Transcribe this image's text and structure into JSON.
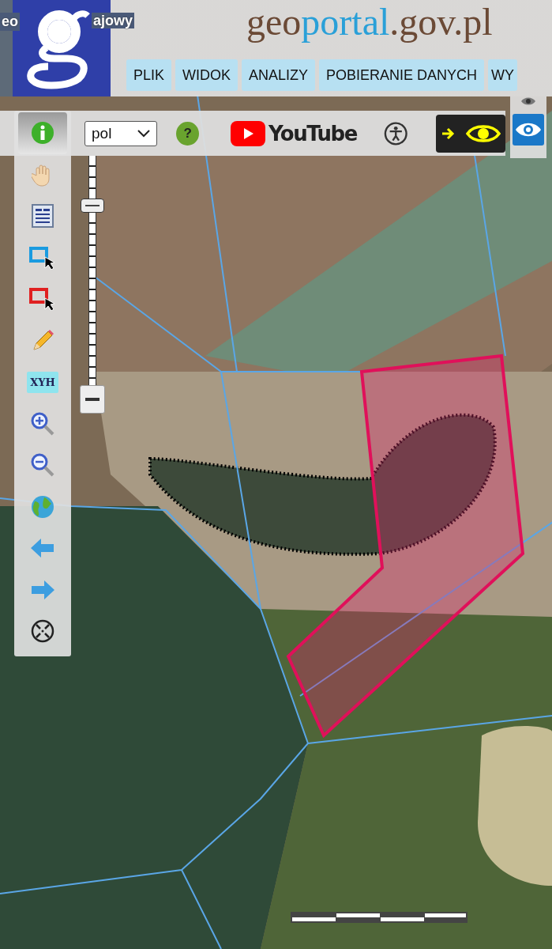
{
  "header": {
    "title_fragments": [
      "eo",
      "ajowy"
    ],
    "site_name": {
      "prefix": "geo",
      "highlight": "portal",
      "suffix": ".gov.pl"
    },
    "menu": [
      {
        "label": "PLIK"
      },
      {
        "label": "WIDOK"
      },
      {
        "label": "ANALIZY"
      },
      {
        "label": "POBIERANIE DANYCH"
      },
      {
        "label": "WY"
      }
    ]
  },
  "toolbar": {
    "language": "pol",
    "help_label": "?",
    "video_label": "YouTube",
    "contrast_toggle": {
      "on": false
    }
  },
  "palette": {
    "tools": [
      {
        "kind": "info",
        "selected": true
      },
      {
        "kind": "pan",
        "selected": false
      },
      {
        "kind": "legend",
        "selected": false
      },
      {
        "kind": "select-blue",
        "selected": false
      },
      {
        "kind": "select-red",
        "selected": false
      },
      {
        "kind": "pencil",
        "selected": false
      },
      {
        "kind": "coords",
        "label": "XYH",
        "selected": false
      },
      {
        "kind": "zoom-in",
        "selected": false
      },
      {
        "kind": "zoom-out",
        "selected": false
      },
      {
        "kind": "globe",
        "selected": false
      },
      {
        "kind": "back",
        "selected": false
      },
      {
        "kind": "forward",
        "selected": false
      },
      {
        "kind": "crosshair",
        "selected": false
      }
    ]
  },
  "zoom_slider": {
    "level": 0.8
  }
}
